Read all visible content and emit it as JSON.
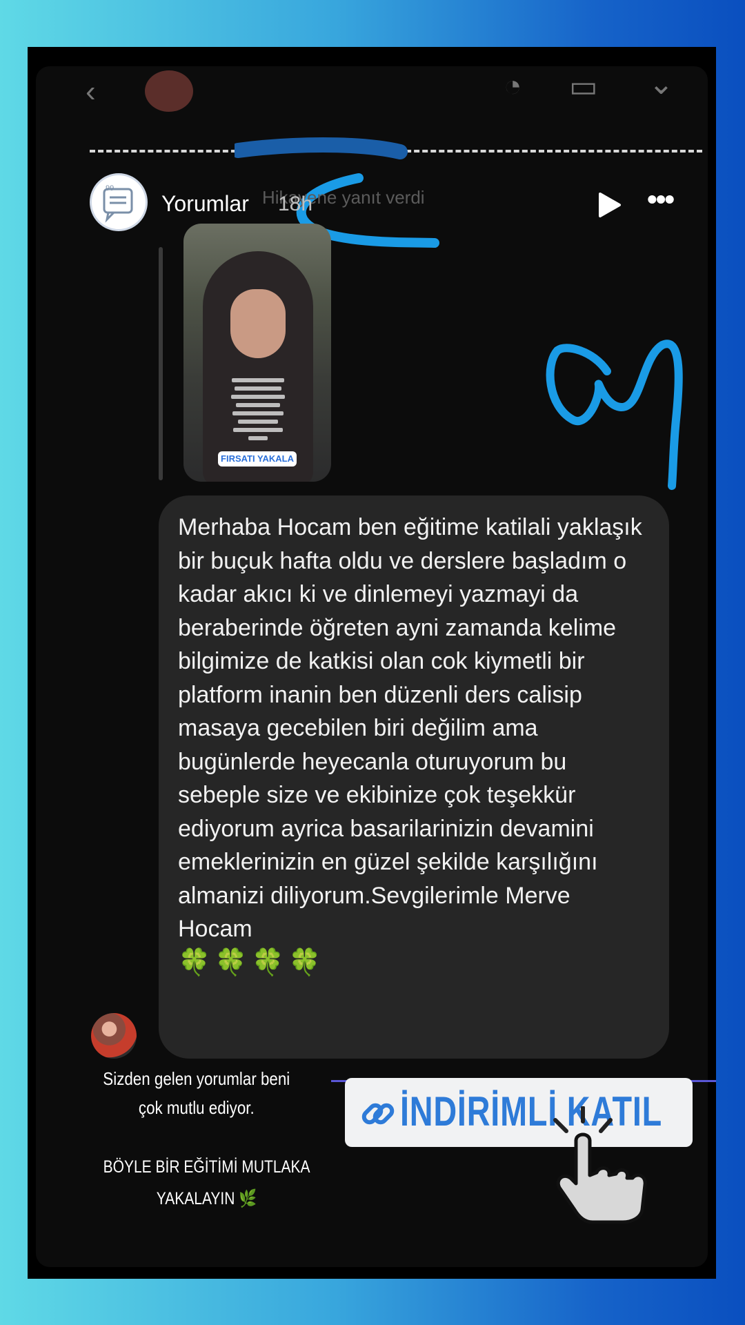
{
  "header": {
    "username": "Yorumlar",
    "time": "18h",
    "ghost_text": "Hikayene yanıt verdi"
  },
  "thumbnail": {
    "cta_label": "FIRSATI YAKALA"
  },
  "message": {
    "text": "Merhaba Hocam ben eğitime katilali yaklaşık bir buçuk hafta oldu ve derslere başladım o kadar akıcı ki ve dinlemeyi yazmayi da beraberinde öğreten ayni zamanda kelime bilgimize de katkisi olan cok kiymetli bir platform inanin ben düzenli ders calisip masaya gecebilen biri değilim ama bugünlerde heyecanla oturuyorum bu sebeple size ve ekibinize çok teşekkür ediyorum ayrica basarilarinizin devamini emeklerinizin en güzel şekilde karşılığını almanizi diliyorum.Sevgilerimle Merve Hocam",
    "emoji": "🍀🍀🍀🍀"
  },
  "overlay": {
    "caption_line1": "Sizden gelen yorumlar beni çok mutlu ediyor.",
    "caption_line2": "BÖYLE BİR EĞİTİMİ MUTLAKA YAKALAYIN 🌿",
    "join_button_label": "İNDİRİMLİ KATIL"
  },
  "colors": {
    "accent_blue": "#2e7bd8",
    "bubble": "#262626",
    "scribble_blue": "#1a9be6"
  }
}
